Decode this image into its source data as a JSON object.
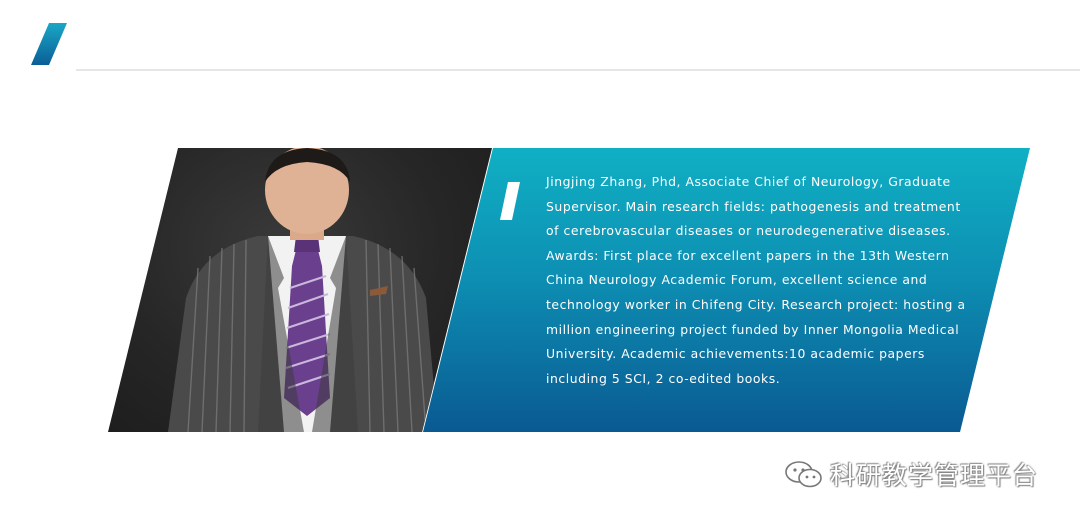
{
  "profile": {
    "bio": "Jingjing Zhang, Phd, Associate Chief of Neurology, Graduate Supervisor. Main research fields: pathogenesis and treatment of cerebrovascular diseases or neurodegenerative diseases. Awards: First place for excellent papers in the 13th Western China Neurology Academic Forum, excellent science and technology worker in Chifeng City. Research project: hosting a million engineering project funded by Inner Mongolia Medical University. Academic achievements:10 academic papers including 5 SCI, 2 co-edited books.",
    "photo_icon": "portrait-photo"
  },
  "watermark": {
    "icon": "wechat-icon",
    "text": "科研教学管理平台"
  },
  "colors": {
    "accent_top": "#10b0c4",
    "accent_bottom": "#0a5a92",
    "photo_bg": "#262626"
  }
}
